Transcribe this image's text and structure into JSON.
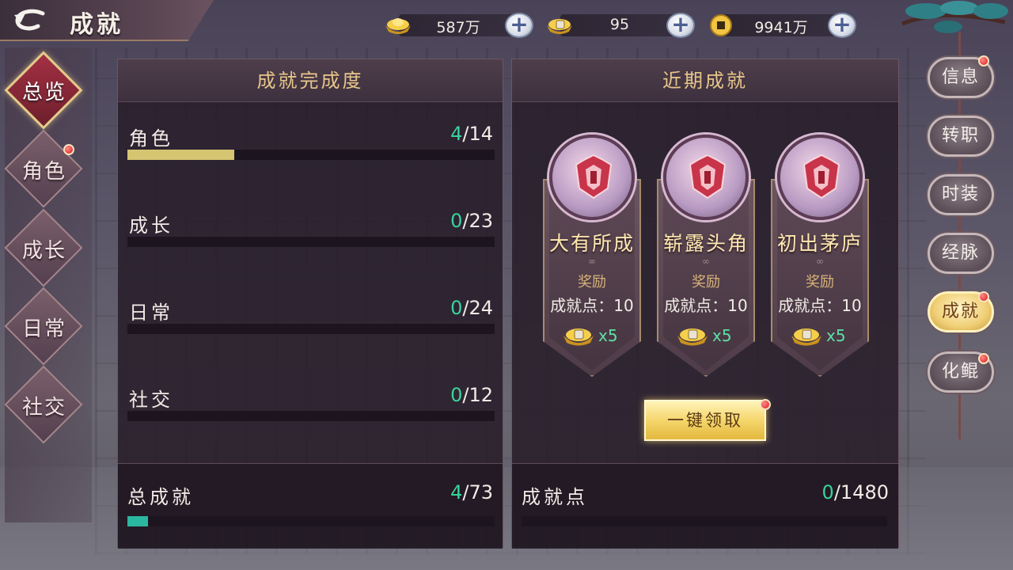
{
  "header": {
    "title": "成就",
    "back_icon": "back-arrow-icon"
  },
  "currencies": [
    {
      "icon": "gold-ingot-icon",
      "value": "587万"
    },
    {
      "icon": "bound-ingot-icon",
      "value": "95"
    },
    {
      "icon": "copper-coin-icon",
      "value": "9941万"
    }
  ],
  "left_nav": [
    {
      "label": "总览",
      "active": true,
      "badge": false
    },
    {
      "label": "角色",
      "active": false,
      "badge": true
    },
    {
      "label": "成长",
      "active": false,
      "badge": false
    },
    {
      "label": "日常",
      "active": false,
      "badge": false
    },
    {
      "label": "社交",
      "active": false,
      "badge": false
    }
  ],
  "completion_panel": {
    "title": "成就完成度",
    "rows": [
      {
        "label": "角色",
        "current": "4",
        "total": "/14",
        "fraction": 0.29
      },
      {
        "label": "成长",
        "current": "0",
        "total": "/23",
        "fraction": 0
      },
      {
        "label": "日常",
        "current": "0",
        "total": "/24",
        "fraction": 0
      },
      {
        "label": "社交",
        "current": "0",
        "total": "/12",
        "fraction": 0
      }
    ],
    "total": {
      "label": "总成就",
      "current": "4",
      "total": "/73",
      "fraction": 0.055
    }
  },
  "recent_panel": {
    "title": "近期成就",
    "achievements": [
      {
        "name": "大有所成",
        "reward_title": "奖励",
        "points": "成就点：10",
        "reward_icon": "bound-ingot-icon",
        "reward_mult": "x5"
      },
      {
        "name": "崭露头角",
        "reward_title": "奖励",
        "points": "成就点：10",
        "reward_icon": "bound-ingot-icon",
        "reward_mult": "x5"
      },
      {
        "name": "初出茅庐",
        "reward_title": "奖励",
        "points": "成就点：10",
        "reward_icon": "bound-ingot-icon",
        "reward_mult": "x5"
      }
    ],
    "claim_label": "一键领取",
    "points": {
      "label": "成就点",
      "current": "0",
      "total": "/1480",
      "fraction": 0
    }
  },
  "right_nav": [
    {
      "label": "信息",
      "active": false,
      "badge": true
    },
    {
      "label": "转职",
      "active": false,
      "badge": false
    },
    {
      "label": "时装",
      "active": false,
      "badge": false
    },
    {
      "label": "经脉",
      "active": false,
      "badge": false
    },
    {
      "label": "成就",
      "active": true,
      "badge": true
    },
    {
      "label": "化鲲",
      "active": false,
      "badge": true
    }
  ],
  "colors": {
    "accent_gold": "#e7c68a",
    "progress_green": "#38d39a",
    "bar_role": "#d6c570",
    "bar_total": "#2ab8a0",
    "badge_red": "#d81818"
  }
}
